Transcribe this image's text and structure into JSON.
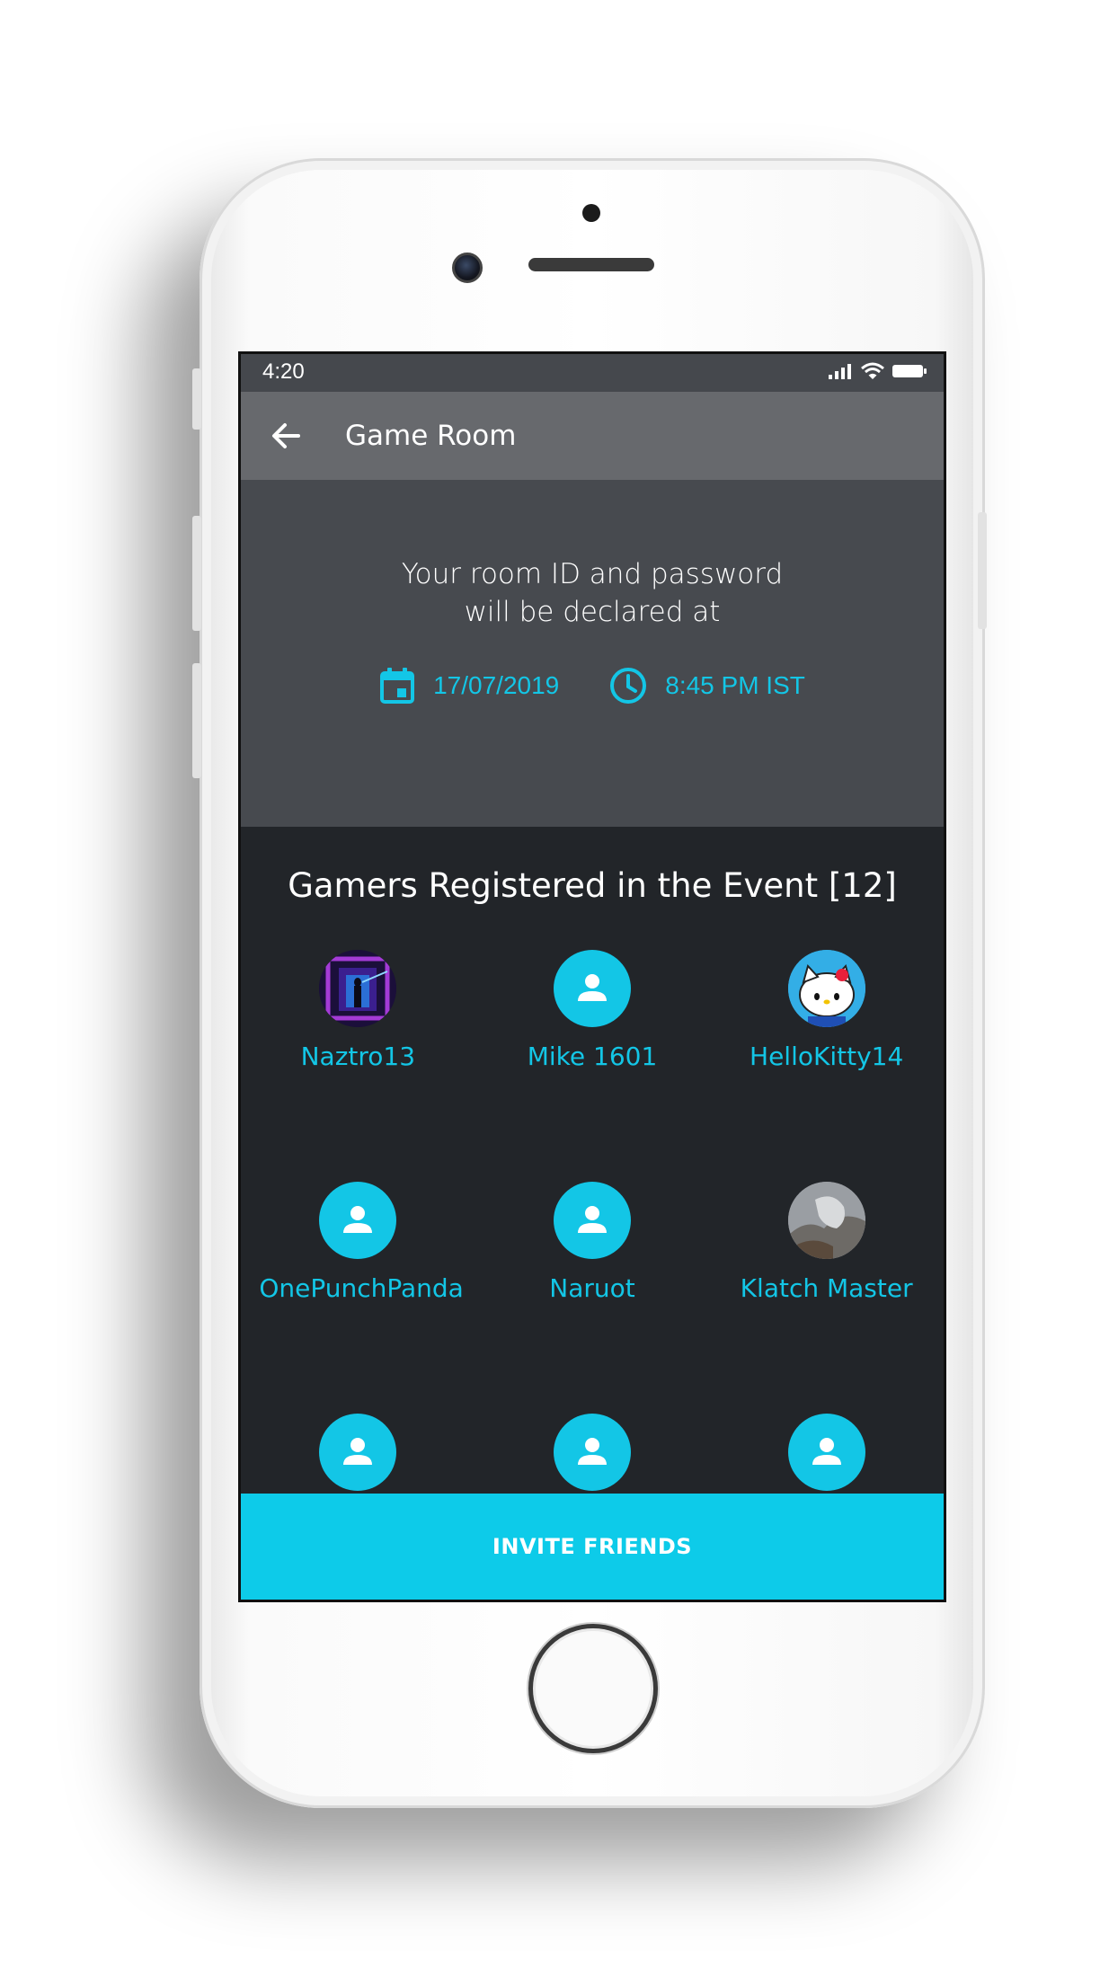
{
  "status_bar": {
    "time": "4:20",
    "icons": [
      "signal-icon",
      "wifi-icon",
      "battery-icon"
    ]
  },
  "app_bar": {
    "back_icon": "arrow-left-icon",
    "title": "Game Room"
  },
  "room_info": {
    "line1": "Your room ID and password",
    "line2": "will be declared at",
    "date": "17/07/2019",
    "time": "8:45 PM IST",
    "date_icon": "calendar-icon",
    "time_icon": "clock-icon"
  },
  "gamers": {
    "heading": "Gamers Registered in the Event [12]",
    "items": [
      {
        "name": "Naztro13",
        "avatar": "photo-neon-corridor"
      },
      {
        "name": "Mike 1601",
        "avatar": "user-placeholder-icon"
      },
      {
        "name": "HelloKitty14",
        "avatar": "photo-hello-kitty"
      },
      {
        "name": "OnePunchPanda",
        "avatar": "user-placeholder-icon"
      },
      {
        "name": "Naruot",
        "avatar": "user-placeholder-icon"
      },
      {
        "name": "Klatch Master",
        "avatar": "photo-grey-landscape"
      },
      {
        "name": "",
        "avatar": "user-placeholder-icon"
      },
      {
        "name": "",
        "avatar": "user-placeholder-icon"
      },
      {
        "name": "",
        "avatar": "user-placeholder-icon"
      }
    ]
  },
  "invite_button": {
    "label": "INVITE FRIENDS"
  },
  "colors": {
    "accent": "#13c6e6",
    "app_bar": "#67696d",
    "panel": "#474a4f",
    "background": "#222529"
  }
}
